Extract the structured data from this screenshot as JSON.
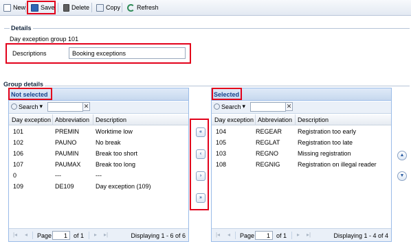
{
  "toolbar": {
    "new_label": "New",
    "save_label": "Save",
    "delete_label": "Delete",
    "copy_label": "Copy",
    "refresh_label": "Refresh"
  },
  "details": {
    "legend": "Details",
    "group_name": "Day exception group 101",
    "descriptions_label": "Descriptions",
    "descriptions_value": "Booking exceptions"
  },
  "group_details": {
    "legend": "Group details"
  },
  "not_selected": {
    "title": "Not selected",
    "search_label": "Search",
    "clear_label": "✕",
    "columns": [
      "Day exception",
      "Abbreviation",
      "Description"
    ],
    "rows": [
      [
        "101",
        "PREMIN",
        "Worktime low"
      ],
      [
        "102",
        "PAUNO",
        "No break"
      ],
      [
        "106",
        "PAUMIN",
        "Break too short"
      ],
      [
        "107",
        "PAUMAX",
        "Break too long"
      ],
      [
        "0",
        "---",
        "---"
      ],
      [
        "109",
        "DE109",
        "Day exception (109)"
      ]
    ],
    "pager": {
      "page_label": "Page",
      "page_value": "1",
      "of_label": "of 1",
      "display": "Displaying 1 - 6 of 6"
    }
  },
  "selected": {
    "title": "Selected",
    "search_label": "Search",
    "clear_label": "✕",
    "columns": [
      "Day exception",
      "Abbreviation",
      "Description"
    ],
    "rows": [
      [
        "104",
        "REGEAR",
        "Registration too early"
      ],
      [
        "105",
        "REGLAT",
        "Registration too late"
      ],
      [
        "103",
        "REGNO",
        "Missing registration"
      ],
      [
        "108",
        "REGNIG",
        "Registration on illegal reader"
      ]
    ],
    "pager": {
      "page_label": "Page",
      "page_value": "1",
      "of_label": "of 1",
      "display": "Displaying 1 - 4 of 4"
    }
  },
  "move_buttons": [
    "«",
    "‹",
    "›",
    "»"
  ],
  "order_buttons": [
    "▲",
    "▼"
  ],
  "colors": {
    "highlight": "#e2001a",
    "panel_title": "#15428b",
    "panel_border": "#99bbe8"
  }
}
